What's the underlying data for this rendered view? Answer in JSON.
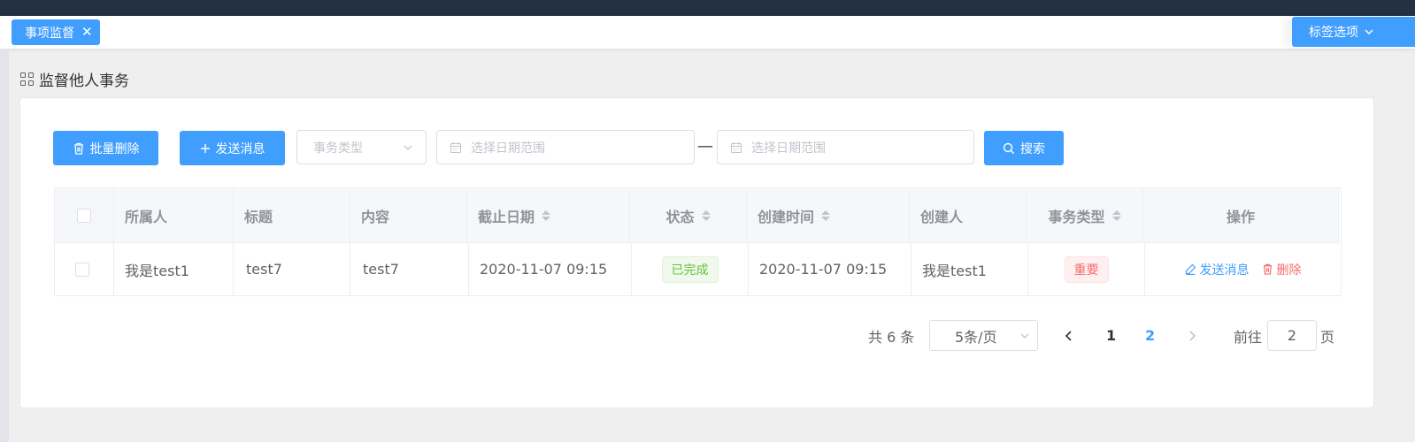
{
  "tabs": {
    "active_label": "事项监督",
    "options_label": "标签选项"
  },
  "page": {
    "title": "监督他人事务"
  },
  "toolbar": {
    "batch_delete_label": "批量删除",
    "send_message_label": "发送消息",
    "type_placeholder": "事务类型",
    "date_start_placeholder": "选择日期范围",
    "date_separator": "—",
    "date_end_placeholder": "选择日期范围",
    "search_label": "搜索"
  },
  "table": {
    "columns": [
      "所属人",
      "标题",
      "内容",
      "截止日期",
      "状态",
      "创建时间",
      "创建人",
      "事务类型",
      "操作"
    ],
    "rows": [
      {
        "owner": "我是test1",
        "title": "test7",
        "content": "test7",
        "deadline": "2020-11-07 09:15",
        "status": "已完成",
        "created_at": "2020-11-07 09:15",
        "creator": "我是test1",
        "type": "重要",
        "action_send": "发送消息",
        "action_delete": "删除"
      }
    ]
  },
  "pagination": {
    "total_text": "共 6 条",
    "page_size": "5条/页",
    "pages": [
      "1",
      "2"
    ],
    "current_page": "2",
    "goto_prefix": "前往",
    "goto_value": "2",
    "goto_suffix": "页"
  },
  "colors": {
    "primary": "#409eff",
    "success": "#67c23a",
    "danger": "#f56c6c",
    "header_bar": "#243144"
  }
}
